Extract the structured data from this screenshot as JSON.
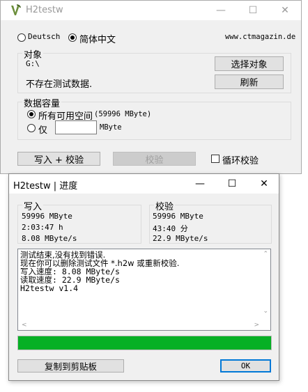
{
  "main_window": {
    "title": "H2testw",
    "url": "www.ctmagazin.de",
    "languages": [
      {
        "label": "Deutsch",
        "selected": false
      },
      {
        "label": "简体中文",
        "selected": true
      }
    ],
    "target": {
      "group_label": "对象",
      "path": "G:\\",
      "select_button": "选择对象",
      "status": "不存在测试数据.",
      "refresh_button": "刷新"
    },
    "capacity": {
      "group_label": "数据容量",
      "all_space_label": "所有可用空间",
      "all_space_value": "(59996 MByte)",
      "only_label": "仅",
      "only_value": "",
      "unit": "MByte"
    },
    "write_verify_button": "写入 + 校验",
    "verify_button": "校验",
    "loop_verify_label": "循环校验"
  },
  "progress_window": {
    "title": "H2testw | 进度",
    "write": {
      "label": "写入",
      "size": "59996 MByte",
      "time": "2:03:47 h",
      "speed": "8.08 MByte/s"
    },
    "verify": {
      "label": "校验",
      "size": "59996 MByte",
      "time": "43:40 分",
      "speed": "22.9 MByte/s"
    },
    "log_lines": [
      "测试结束,没有找到错误.",
      "现在你可以删除测试文件 *.h2w 或重新校验.",
      "写入速度: 8.08 MByte/s",
      "读取速度: 22.9 MByte/s",
      "H2testw v1.4"
    ],
    "progress_fraction": 1.0,
    "progress_color": "#06b025",
    "copy_button": "复制到剪贴板",
    "ok_button": "OK"
  }
}
